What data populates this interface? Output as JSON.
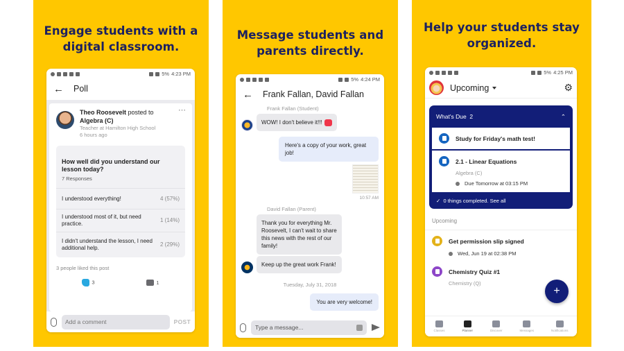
{
  "colors": {
    "background_yellow": "#ffc700",
    "headline_navy": "#1c2160",
    "planner_navy": "#121e78",
    "like_blue": "#29a8e0"
  },
  "panels": [
    {
      "headline": [
        "Engage students with a",
        "digital classroom."
      ],
      "status_time": "4:23 PM",
      "status_battery": "5%",
      "screen_title": "Poll",
      "post": {
        "author": "Theo Roosevelt",
        "action": " posted to",
        "group": "Algebra (C)",
        "role": "Teacher at Hamilton High School",
        "time": "6 hours ago",
        "more_icon": "⋯",
        "poll": {
          "question": "How well did you understand our lesson today?",
          "responses": "7 Responses",
          "options": [
            {
              "label": "I understood everything!",
              "count": "4 (57%)"
            },
            {
              "label": "I understood most of it, but need practice.",
              "count": "1 (14%)"
            },
            {
              "label": "I didn't understand the lesson, I need additional help.",
              "count": "2 (29%)"
            }
          ]
        },
        "likes_text": "3 people liked this post",
        "like_count": "3",
        "comment_count": "1"
      },
      "composer": {
        "placeholder": "Add a comment",
        "post_label": "POST"
      }
    },
    {
      "headline": [
        "Message students and",
        "parents directly."
      ],
      "status_time": "4:24 PM",
      "status_battery": "5%",
      "screen_title": "Frank Fallan, David Fallan",
      "messages": {
        "sender1": "Frank Fallan (Student)",
        "m1": "WOW! I don't believe it!!!",
        "m2": "Here's a copy of your work, great job!",
        "m2_time": "10:57 AM",
        "sender2": "David Fallan (Parent)",
        "m3": "Thank you for everything Mr. Roosevelt, I can't wait to share this news with the rest of our family!",
        "m4": "Keep up the great work Frank!",
        "date": "Tuesday, July 31, 2018",
        "m5": "You are very welcome!"
      },
      "composer": {
        "placeholder": "Type a message..."
      }
    },
    {
      "headline": [
        "Help your students stay",
        "organized."
      ],
      "status_time": "4:25 PM",
      "status_battery": "5%",
      "view_label": "Upcoming",
      "whats_due": {
        "label": "What's Due",
        "count": "2",
        "items": [
          {
            "title": "Study for Friday's math test!"
          },
          {
            "title": "2.1 - Linear Equations",
            "subject": "Algebra (C)",
            "due": "Due Tomorrow at 03:15 PM"
          }
        ],
        "completed": "0 things completed. See all"
      },
      "upcoming": {
        "label": "Upcoming",
        "items": [
          {
            "title": "Get permission slip signed",
            "due": "Wed, Jun 19 at 02:38 PM"
          },
          {
            "title": "Chemistry Quiz #1",
            "subject": "Chemistry (Q)"
          }
        ]
      },
      "fab_label": "+",
      "nav": [
        "Classes",
        "Planner",
        "Discover",
        "Messages",
        "Notifications"
      ]
    }
  ]
}
